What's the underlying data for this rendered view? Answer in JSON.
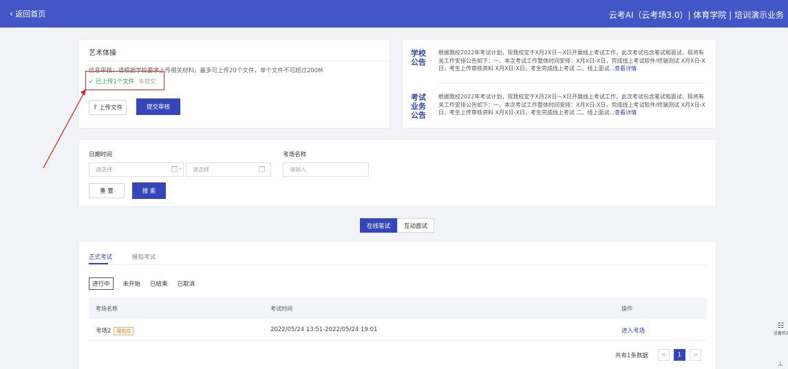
{
  "header": {
    "back_label": "返回首页",
    "brand": "云考AI（云考场3.0）| 体育学院 | 培训演示业务"
  },
  "upload_card": {
    "title": "艺术体操",
    "info": "信息审核：请根据学校要求上传相关材料，最多可上传20个文件，单个文件不可超过200M",
    "status_uploaded": "✓ 已上传1个文件",
    "status_pending": "未提交",
    "upload_button": "上传文件",
    "submit_button": "提交审核"
  },
  "notices": [
    {
      "label": "学校公告",
      "text": "根据我校2022年考试计划，现我校定于X月2X日—X日开展线上考试工作，此次考试包含笔试和面试，现将有关工作安排公告如下：一、本次考试工作整体时间安排：X月X日-X日，完成线上考试软件/终端测试 X月X日-X日，考生上传审核资料 X月X日-X日，考生完成线上考试 二、线上面试",
      "more": "...查看详情"
    },
    {
      "label": "考试业务公告",
      "text": "根据我校2022年考试计划，现我校定于X月2X日—X日开展线上考试工作，此次考试包含笔试和面试，现将有关工作安排公告如下：一、本次考试工作整体时间安排：X月X日-X日，完成线上考试软件/终端测试 X月X日-X日，考生上传审核资料 X月X日-X日，考生完成线上考试 二、线上面试",
      "more": "...查看详情"
    }
  ],
  "search": {
    "date_label": "日期时间",
    "date_start_placeholder": "请选择",
    "date_separator": "-",
    "date_end_placeholder": "请选择",
    "room_label": "考场名称",
    "room_placeholder": "请输入",
    "reset_button": "重 置",
    "search_button": "搜 索"
  },
  "mode_toggle": {
    "options": [
      "在线笔试",
      "互动面试"
    ],
    "selected": "在线笔试"
  },
  "exam_list": {
    "tabs": [
      "正式考试",
      "模拟考试"
    ],
    "active_tab": "正式考试",
    "status_filters": [
      "进行中",
      "未开始",
      "已结束",
      "已取消"
    ],
    "active_status": "进行中",
    "columns": [
      "考场名称",
      "考试时间",
      "操作"
    ],
    "rows": [
      {
        "name": "考场2",
        "badge": "双机位",
        "time": "2022/05/24 13:51-2022/05/24 19:01",
        "action": "进入考场"
      }
    ],
    "pagination": {
      "total_text": "共有1条数据",
      "prev": "<",
      "current": "1",
      "next": ">"
    }
  },
  "side_tool": {
    "label": "设备检测"
  },
  "colors": {
    "primary": "#3446b9",
    "header_bg": "#4356c8",
    "highlight_box": "#e02424",
    "success": "#2fa84f"
  }
}
